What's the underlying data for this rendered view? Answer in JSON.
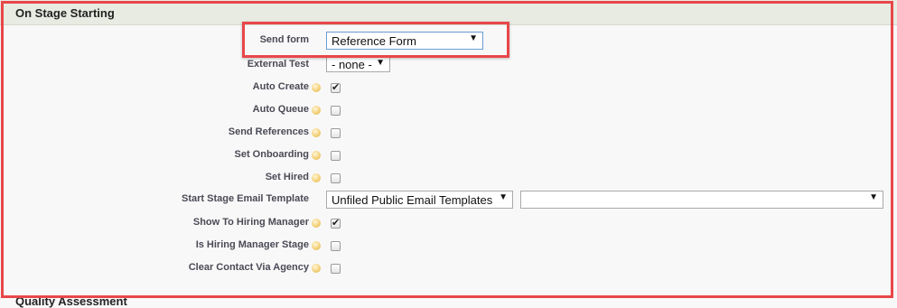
{
  "section": {
    "title": "On Stage Starting"
  },
  "send_form": {
    "label": "Send form",
    "value": "Reference Form"
  },
  "external_test": {
    "label": "External Test",
    "value": "- none -"
  },
  "auto_create": {
    "label": "Auto Create",
    "checked": true
  },
  "auto_queue": {
    "label": "Auto Queue",
    "checked": false
  },
  "send_references": {
    "label": "Send References",
    "checked": false
  },
  "set_onboarding": {
    "label": "Set Onboarding",
    "checked": false
  },
  "set_hired": {
    "label": "Set Hired",
    "checked": false
  },
  "start_stage_email_template": {
    "label": "Start Stage Email Template",
    "folder": "Unfiled Public Email Templates",
    "template": ""
  },
  "show_to_hiring_manager": {
    "label": "Show To Hiring Manager",
    "checked": true
  },
  "is_hiring_manager_stage": {
    "label": "Is Hiring Manager Stage",
    "checked": false
  },
  "clear_contact_via_agency": {
    "label": "Clear Contact Via Agency",
    "checked": false
  },
  "next_section_partial": "Quality Assessment",
  "icons": {
    "help": "help-icon",
    "dropdown": "dropdown-arrow-icon",
    "checkmark": "checkmark-icon"
  },
  "colors": {
    "highlight_border": "#e8474a",
    "header_bg": "#e8ebe2",
    "page_bg": "#f8f8f8"
  }
}
